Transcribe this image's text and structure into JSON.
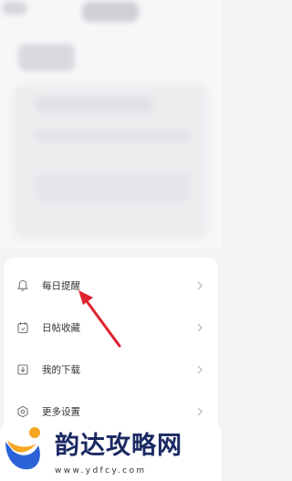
{
  "menu": {
    "items": [
      {
        "label": "每日提醒",
        "icon": "bell-icon"
      },
      {
        "label": "日帖收藏",
        "icon": "calendar-icon"
      },
      {
        "label": "我的下载",
        "icon": "download-icon"
      },
      {
        "label": "更多设置",
        "icon": "settings-icon"
      }
    ]
  },
  "watermark": {
    "title": "韵达攻略网",
    "url": "www.ydfcy.com"
  },
  "colors": {
    "annotation_arrow": "#e0232e",
    "watermark_text": "#1b2a63",
    "watermark_logo_orange": "#f5a623",
    "watermark_logo_blue": "#2a62d8"
  }
}
